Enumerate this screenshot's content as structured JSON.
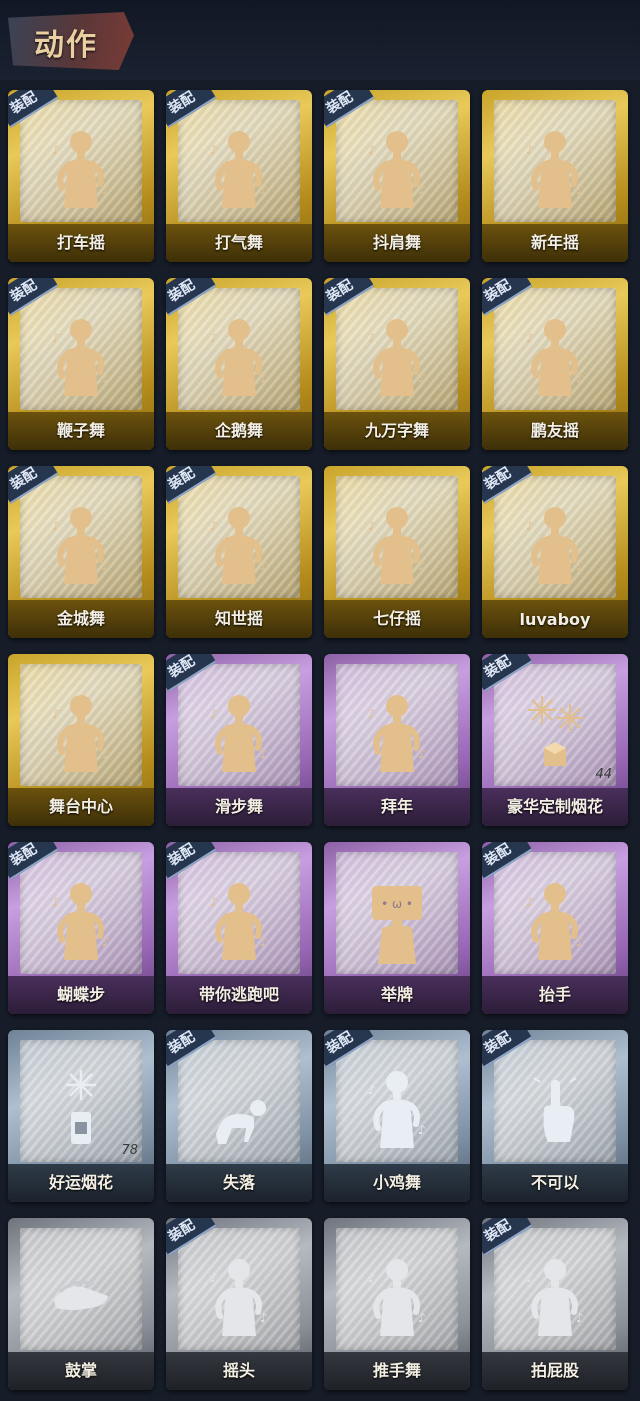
{
  "header": {
    "title": "动作"
  },
  "cards": [
    {
      "label": "打车摇",
      "rarity": "gold",
      "equipped": true,
      "icon": "figure-dance-icon"
    },
    {
      "label": "打气舞",
      "rarity": "gold",
      "equipped": true,
      "icon": "figure-dance-icon"
    },
    {
      "label": "抖肩舞",
      "rarity": "gold",
      "equipped": true,
      "icon": "figure-dance-icon"
    },
    {
      "label": "新年摇",
      "rarity": "gold",
      "equipped": false,
      "icon": "figure-dance-icon"
    },
    {
      "label": "鞭子舞",
      "rarity": "gold",
      "equipped": true,
      "icon": "figure-dance-icon"
    },
    {
      "label": "企鹅舞",
      "rarity": "gold",
      "equipped": true,
      "icon": "figure-dance-icon"
    },
    {
      "label": "九万字舞",
      "rarity": "gold",
      "equipped": true,
      "icon": "figure-dance-icon"
    },
    {
      "label": "鹏友摇",
      "rarity": "gold",
      "equipped": true,
      "icon": "figure-dance-icon"
    },
    {
      "label": "金城舞",
      "rarity": "gold",
      "equipped": true,
      "icon": "figure-dance-icon"
    },
    {
      "label": "知世摇",
      "rarity": "gold",
      "equipped": true,
      "icon": "figure-dance-icon"
    },
    {
      "label": "七仔摇",
      "rarity": "gold",
      "equipped": false,
      "icon": "figure-dance-icon"
    },
    {
      "label": "luvaboy",
      "rarity": "gold",
      "equipped": true,
      "icon": "figure-dance-icon"
    },
    {
      "label": "舞台中心",
      "rarity": "gold",
      "equipped": false,
      "icon": "figure-dance-icon"
    },
    {
      "label": "滑步舞",
      "rarity": "purple",
      "equipped": true,
      "icon": "figure-dance-icon"
    },
    {
      "label": "拜年",
      "rarity": "purple",
      "equipped": false,
      "icon": "figure-bow-icon"
    },
    {
      "label": "豪华定制烟花",
      "rarity": "purple",
      "equipped": true,
      "icon": "fireworks-box-icon",
      "count": "44"
    },
    {
      "label": "蝴蝶步",
      "rarity": "purple",
      "equipped": true,
      "icon": "figure-point-icon"
    },
    {
      "label": "带你逃跑吧",
      "rarity": "purple",
      "equipped": true,
      "icon": "figure-point-icon"
    },
    {
      "label": "举牌",
      "rarity": "purple",
      "equipped": false,
      "icon": "sign-board-icon"
    },
    {
      "label": "抬手",
      "rarity": "purple",
      "equipped": true,
      "icon": "figure-raise-hand-icon"
    },
    {
      "label": "好运烟花",
      "rarity": "blue",
      "equipped": false,
      "icon": "fireworks-can-icon",
      "count": "78"
    },
    {
      "label": "失落",
      "rarity": "blue",
      "equipped": true,
      "icon": "figure-crawl-icon"
    },
    {
      "label": "小鸡舞",
      "rarity": "blue",
      "equipped": true,
      "icon": "figure-chicken-icon"
    },
    {
      "label": "不可以",
      "rarity": "blue",
      "equipped": true,
      "icon": "finger-wag-icon"
    },
    {
      "label": "鼓掌",
      "rarity": "gray",
      "equipped": false,
      "icon": "clapping-hands-icon"
    },
    {
      "label": "摇头",
      "rarity": "gray",
      "equipped": true,
      "icon": "figure-shake-head-icon"
    },
    {
      "label": "推手舞",
      "rarity": "gray",
      "equipped": false,
      "icon": "figure-push-hands-icon"
    },
    {
      "label": "拍屁股",
      "rarity": "gray",
      "equipped": true,
      "icon": "figure-pat-icon"
    }
  ],
  "equip_badge": "装配"
}
